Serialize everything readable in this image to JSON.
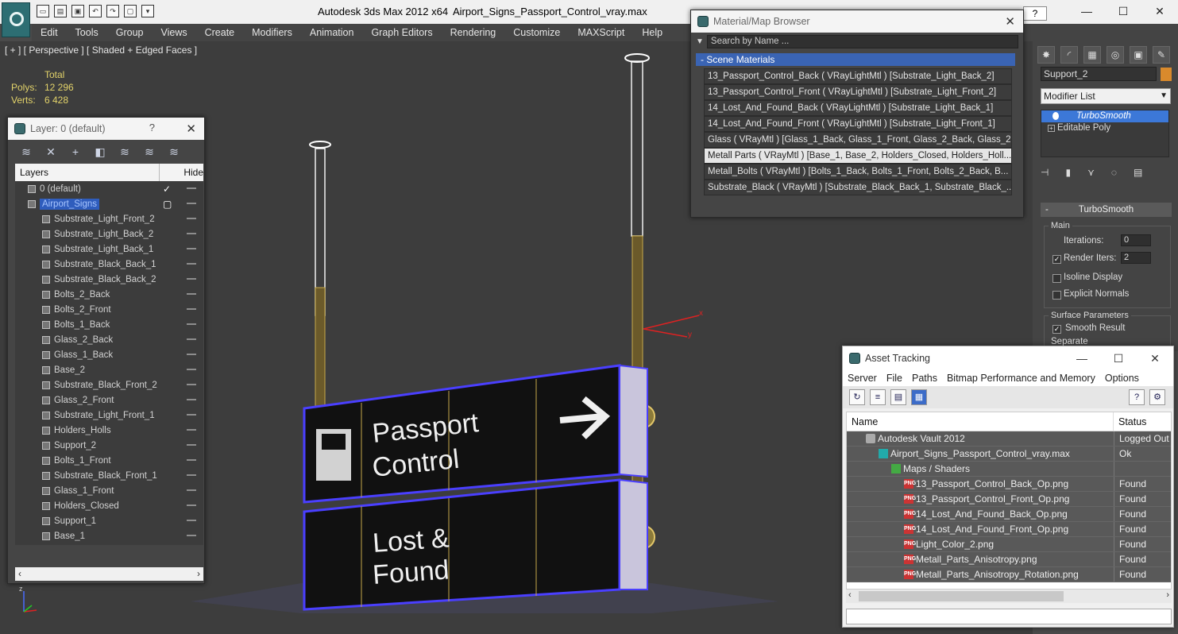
{
  "app": {
    "title": "Autodesk 3ds Max  2012 x64",
    "file": "Airport_Signs_Passport_Control_vray.max",
    "help": "?"
  },
  "menu": [
    "Edit",
    "Tools",
    "Group",
    "Views",
    "Create",
    "Modifiers",
    "Animation",
    "Graph Editors",
    "Rendering",
    "Customize",
    "MAXScript",
    "Help"
  ],
  "viewport": {
    "label": "[ + ] [ Perspective ] [ Shaded + Edged Faces ]",
    "stats_header": "Total",
    "polys_label": "Polys:",
    "polys": "12 296",
    "verts_label": "Verts:",
    "verts": "6 428",
    "sign_top_line1": "Passport",
    "sign_top_line2": "Control",
    "sign_bottom_line1": "Lost &",
    "sign_bottom_line2": "Found",
    "axis_x": "x",
    "axis_y": "y",
    "axis_z": "z"
  },
  "layer_dialog": {
    "title": "Layer: 0 (default)",
    "col_layers": "Layers",
    "col_hide": "Hide",
    "rows": [
      {
        "name": "0 (default)",
        "level": 1,
        "checked": true
      },
      {
        "name": "Airport_Signs",
        "level": 1,
        "selected": true
      },
      {
        "name": "Substrate_Light_Front_2",
        "level": 2
      },
      {
        "name": "Substrate_Light_Back_2",
        "level": 2
      },
      {
        "name": "Substrate_Light_Back_1",
        "level": 2
      },
      {
        "name": "Substrate_Black_Back_1",
        "level": 2
      },
      {
        "name": "Substrate_Black_Back_2",
        "level": 2
      },
      {
        "name": "Bolts_2_Back",
        "level": 2
      },
      {
        "name": "Bolts_2_Front",
        "level": 2
      },
      {
        "name": "Bolts_1_Back",
        "level": 2
      },
      {
        "name": "Glass_2_Back",
        "level": 2
      },
      {
        "name": "Glass_1_Back",
        "level": 2
      },
      {
        "name": "Base_2",
        "level": 2
      },
      {
        "name": "Substrate_Black_Front_2",
        "level": 2
      },
      {
        "name": "Glass_2_Front",
        "level": 2
      },
      {
        "name": "Substrate_Light_Front_1",
        "level": 2
      },
      {
        "name": "Holders_Holls",
        "level": 2
      },
      {
        "name": "Support_2",
        "level": 2
      },
      {
        "name": "Bolts_1_Front",
        "level": 2
      },
      {
        "name": "Substrate_Black_Front_1",
        "level": 2
      },
      {
        "name": "Glass_1_Front",
        "level": 2
      },
      {
        "name": "Holders_Closed",
        "level": 2
      },
      {
        "name": "Support_1",
        "level": 2
      },
      {
        "name": "Base_1",
        "level": 2
      }
    ]
  },
  "material_browser": {
    "title": "Material/Map Browser",
    "search_placeholder": "Search by Name ...",
    "section": "- Scene Materials",
    "items": [
      "13_Passport_Control_Back ( VRayLightMtl ) [Substrate_Light_Back_2]",
      "13_Passport_Control_Front ( VRayLightMtl ) [Substrate_Light_Front_2]",
      "14_Lost_And_Found_Back ( VRayLightMtl ) [Substrate_Light_Back_1]",
      "14_Lost_And_Found_Front ( VRayLightMtl ) [Substrate_Light_Front_1]",
      "Glass ( VRayMtl ) [Glass_1_Back, Glass_1_Front, Glass_2_Back, Glass_2...",
      "Metall Parts ( VRayMtl ) [Base_1, Base_2, Holders_Closed, Holders_Holl...",
      "Metall_Bolts ( VRayMtl ) [Bolts_1_Back, Bolts_1_Front, Bolts_2_Back, B...",
      "Substrate_Black ( VRayMtl ) [Substrate_Black_Back_1, Substrate_Black_..."
    ],
    "highlighted_index": 5
  },
  "command_panel": {
    "object_name": "Support_2",
    "modifier_list": "Modifier List",
    "stack": [
      "TurboSmooth",
      "Editable Poly"
    ],
    "rollout": "TurboSmooth",
    "group_main": "Main",
    "iterations_label": "Iterations:",
    "iterations": "0",
    "render_iters_label": "Render Iters:",
    "render_iters": "2",
    "isoline": "Isoline Display",
    "explicit_normals": "Explicit Normals",
    "group_surface": "Surface Parameters",
    "smooth_result": "Smooth Result",
    "separate": "Separate",
    "color": "#d98a2c"
  },
  "asset_tracking": {
    "title": "Asset Tracking",
    "menu": [
      "Server",
      "File",
      "Paths",
      "Bitmap Performance and Memory",
      "Options"
    ],
    "col_name": "Name",
    "col_status": "Status",
    "rows": [
      {
        "name": "Autodesk Vault 2012",
        "status": "Logged Out",
        "indent": 1,
        "icon": "vault"
      },
      {
        "name": "Airport_Signs_Passport_Control_vray.max",
        "status": "Ok",
        "indent": 2,
        "icon": "max"
      },
      {
        "name": "Maps / Shaders",
        "status": "",
        "indent": 3,
        "icon": "folder"
      },
      {
        "name": "13_Passport_Control_Back_Op.png",
        "status": "Found",
        "indent": 4,
        "icon": "png"
      },
      {
        "name": "13_Passport_Control_Front_Op.png",
        "status": "Found",
        "indent": 4,
        "icon": "png"
      },
      {
        "name": "14_Lost_And_Found_Back_Op.png",
        "status": "Found",
        "indent": 4,
        "icon": "png"
      },
      {
        "name": "14_Lost_And_Found_Front_Op.png",
        "status": "Found",
        "indent": 4,
        "icon": "png"
      },
      {
        "name": "Light_Color_2.png",
        "status": "Found",
        "indent": 4,
        "icon": "png"
      },
      {
        "name": "Metall_Parts_Anisotropy.png",
        "status": "Found",
        "indent": 4,
        "icon": "png"
      },
      {
        "name": "Metall_Parts_Anisotropy_Rotation.png",
        "status": "Found",
        "indent": 4,
        "icon": "png"
      }
    ]
  }
}
